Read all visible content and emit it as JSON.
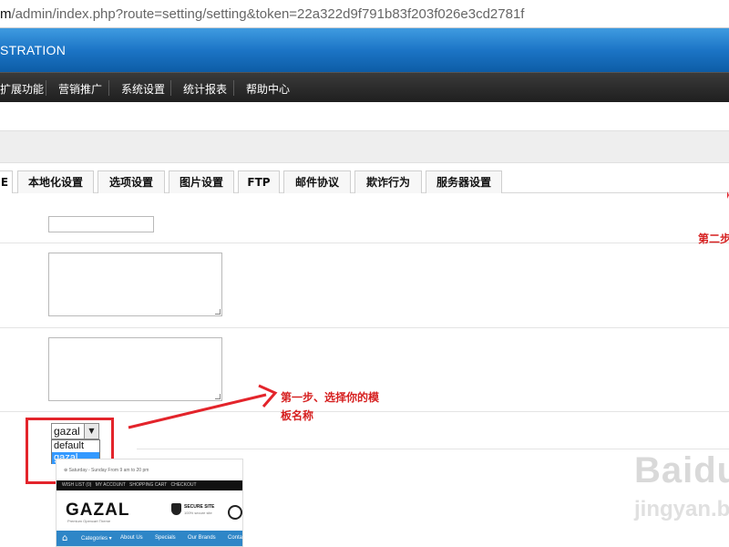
{
  "browser": {
    "address_host": "m",
    "address_path": "/admin/index.php?route=setting/setting&token=22a322d9f791b83f203f026e3cd2781f"
  },
  "header": {
    "title": "STRATION"
  },
  "menu": {
    "items": [
      "扩展功能",
      "营销推广",
      "系统设置",
      "统计报表",
      "帮助中心"
    ]
  },
  "tabs": {
    "partial": "E",
    "items": [
      "本地化设置",
      "选项设置",
      "图片设置",
      "FTP",
      "邮件协议",
      "欺诈行为",
      "服务器设置"
    ]
  },
  "form": {
    "text_value": "",
    "textarea1_value": "",
    "textarea2_value": "",
    "template_select": {
      "selected": "gazal",
      "options": [
        "default",
        "gazal"
      ]
    }
  },
  "annotations": {
    "step1_line1": "第一步、选择你的模",
    "step1_line2": "板名称",
    "step2": "第二步",
    "colors": {
      "annotation": "#d62020"
    }
  },
  "preview": {
    "hours": "Saturday - Sunday From 9 am to 20 pm",
    "links": [
      "WISH LIST (0)",
      "MY ACCOUNT",
      "SHOPPING CART",
      "CHECKOUT"
    ],
    "logo": "GAZAL",
    "logo_sub": "Premium Opencart Theme",
    "secure_title": "SECURE SITE",
    "secure_sub": "100% secure site",
    "nav": [
      "Categories ▾",
      "About Us",
      "Specials",
      "Our Brands",
      "Conta"
    ]
  },
  "watermark": {
    "brand": "Baidu",
    "sub": "jingyan.b"
  }
}
